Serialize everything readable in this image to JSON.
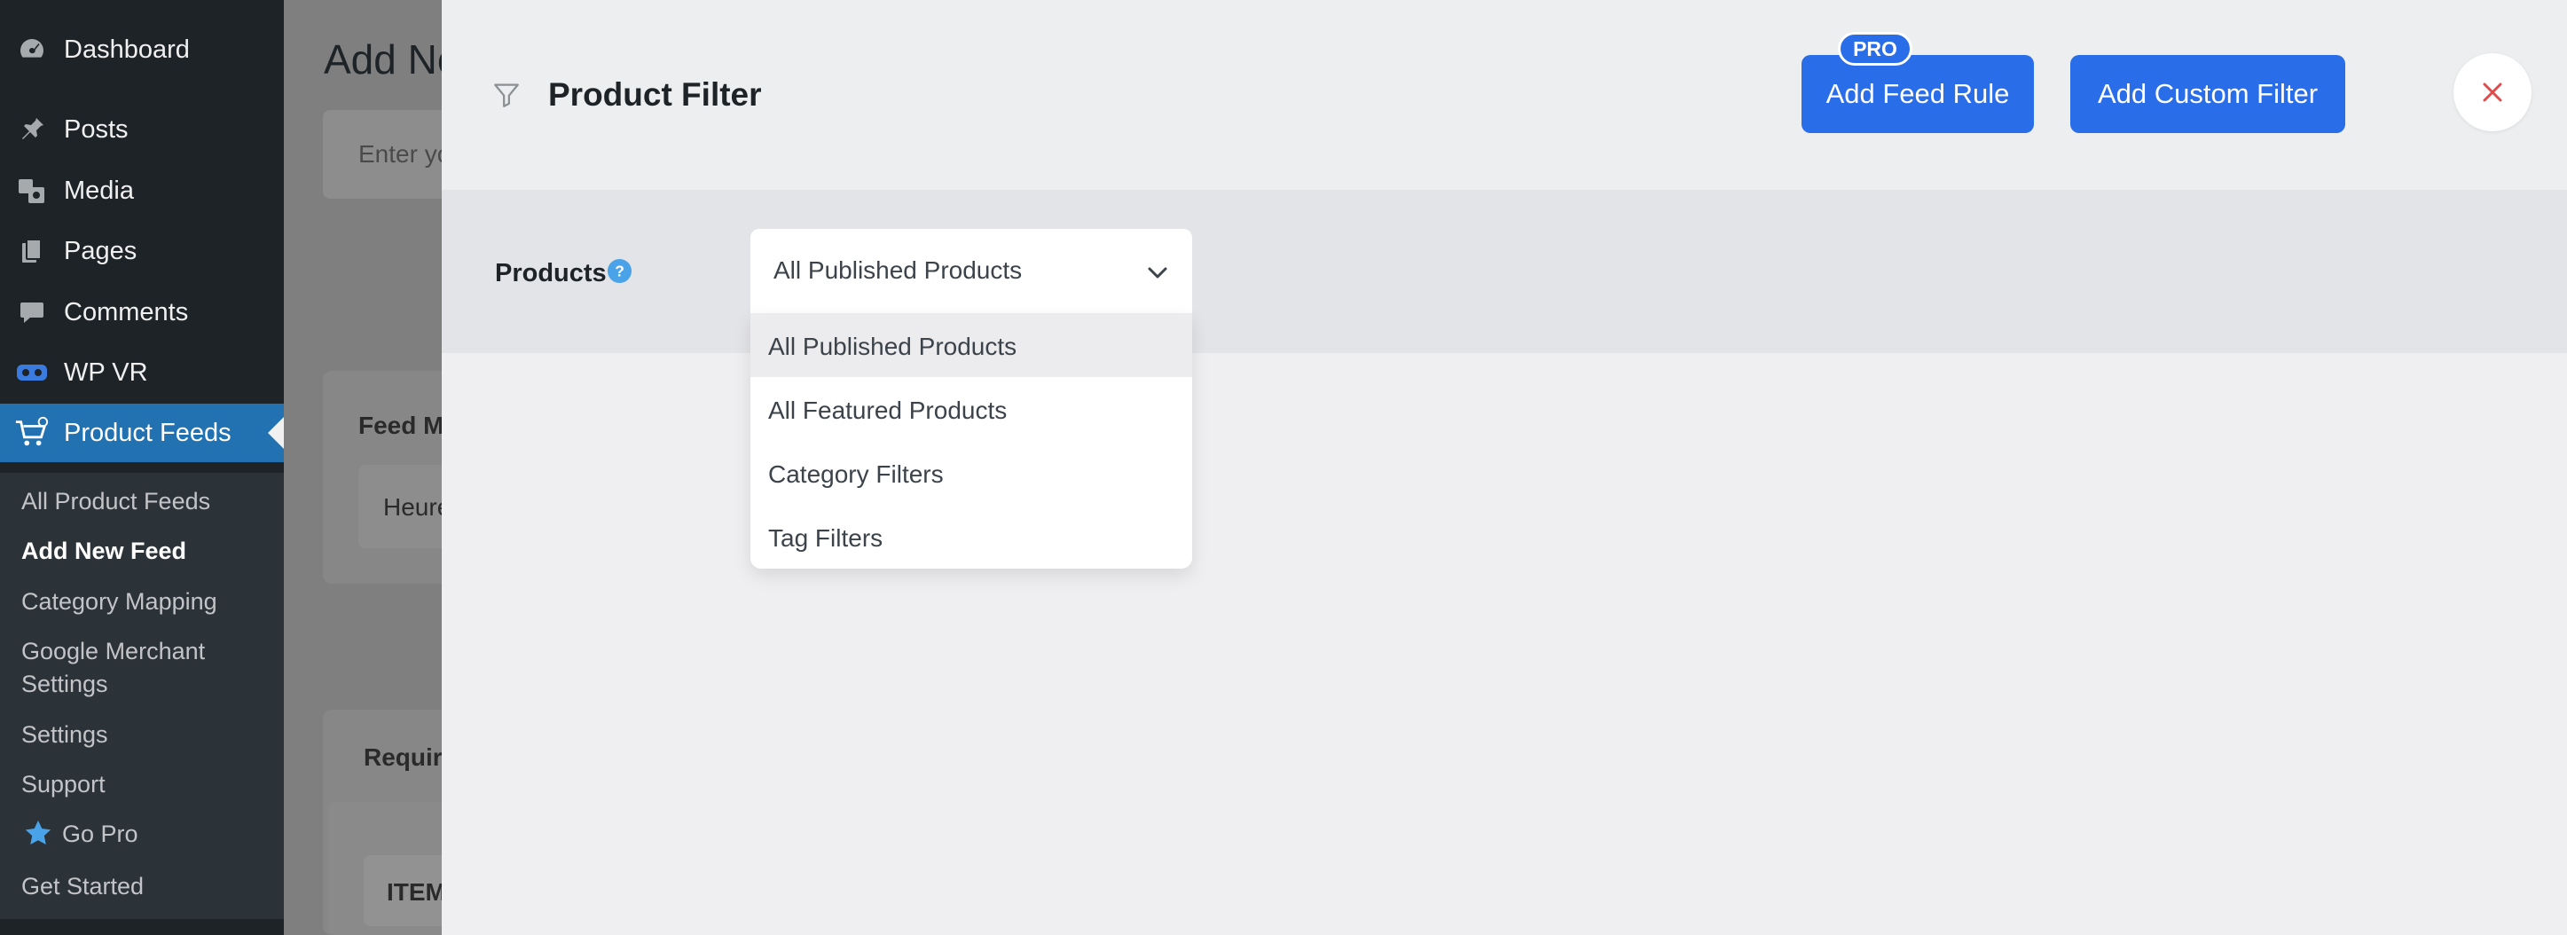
{
  "sidebar": {
    "menu": [
      {
        "label": "Dashboard",
        "icon": "dashboard-icon"
      },
      {
        "label": "Posts",
        "icon": "pin-icon"
      },
      {
        "label": "Media",
        "icon": "media-icon"
      },
      {
        "label": "Pages",
        "icon": "pages-icon"
      },
      {
        "label": "Comments",
        "icon": "comment-icon"
      },
      {
        "label": "WP VR",
        "icon": "vr-headset-icon"
      },
      {
        "label": "Product Feeds",
        "icon": "cart-icon",
        "active": true
      }
    ],
    "submenu": [
      {
        "label": "All Product Feeds"
      },
      {
        "label": "Add New Feed",
        "current": true
      },
      {
        "label": "Category Mapping"
      },
      {
        "label": "Google Merchant\nSettings"
      },
      {
        "label": "Settings"
      },
      {
        "label": "Support"
      },
      {
        "label": "Go Pro",
        "icon": "star-icon"
      },
      {
        "label": "Get Started"
      }
    ]
  },
  "background_page": {
    "title_fragment": "Add Ne",
    "input_placeholder_fragment": "Enter yo",
    "feed_merchant_label_fragment": "Feed Me",
    "merchant_value_fragment": "Heure",
    "required_fragment": "Require",
    "item_fragment": "ITEM"
  },
  "drawer": {
    "title": "Product Filter",
    "title_icon": "filter-icon",
    "add_feed_rule_label": "Add Feed Rule",
    "pro_badge": "PRO",
    "add_custom_filter_label": "Add Custom Filter",
    "close_icon": "close-icon",
    "products_label": "Products",
    "help_icon": "help-icon",
    "select": {
      "value": "All Published Products",
      "options": [
        "All Published Products",
        "All Featured Products",
        "Category Filters",
        "Tag Filters"
      ],
      "highlighted_index": 0
    }
  },
  "colors": {
    "primary_button": "#2a6de8",
    "sidebar_bg": "#1d2327",
    "sidebar_active": "#2271b1",
    "close_icon": "#e04b4b",
    "help_icon": "#4aa3e8"
  }
}
